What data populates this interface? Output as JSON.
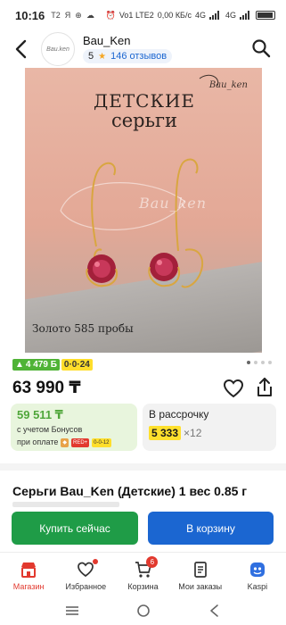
{
  "status_bar": {
    "time": "10:16",
    "left_icons": [
      "T2",
      "Я",
      "⊕",
      "☁"
    ],
    "right_text": "Vo1 LTE2",
    "net_speed": "0,00 КБ/с",
    "net_type_1": "4G",
    "net_type_2": "4G"
  },
  "header": {
    "shop_name": "Bau_Ken",
    "logo_text": "Bau.ken",
    "rating": "5",
    "reviews": "146 отзывов"
  },
  "product_image": {
    "title_line1": "ДЕТСКИЕ",
    "title_line2": "серьги",
    "brand": "Bau_ken",
    "watermark": "Bau_ken",
    "caption": "Золото 585 пробы"
  },
  "badges": {
    "bonus": "4 479 Б",
    "installment": "0·0·24"
  },
  "price": "63 990 ₸",
  "bonus_card": {
    "amount": "59 511 ₸",
    "line1": "с учетом Бонусов",
    "line2": "при оплате",
    "icon_1": "RED+",
    "icon_2": "0-0-12"
  },
  "installment_card": {
    "label": "В рассрочку",
    "amount": "5 333",
    "multiplier": "×12"
  },
  "product_title": "Серьги Bau_Ken (Детские) 1 вес 0.85 г",
  "buttons": {
    "buy_now": "Купить сейчас",
    "add_to_cart": "В корзину"
  },
  "bottom_nav": {
    "items": [
      {
        "label": "Магазин"
      },
      {
        "label": "Избранное"
      },
      {
        "label": "Корзина"
      },
      {
        "label": "Мои заказы"
      },
      {
        "label": "Kaspi"
      }
    ],
    "cart_count": "6"
  },
  "colors": {
    "accent_blue": "#1b66d1",
    "buy_green": "#1f9c47",
    "bonus_green": "#4fb336",
    "highlight_yellow": "#ffde2b",
    "active_red": "#e2392e"
  }
}
